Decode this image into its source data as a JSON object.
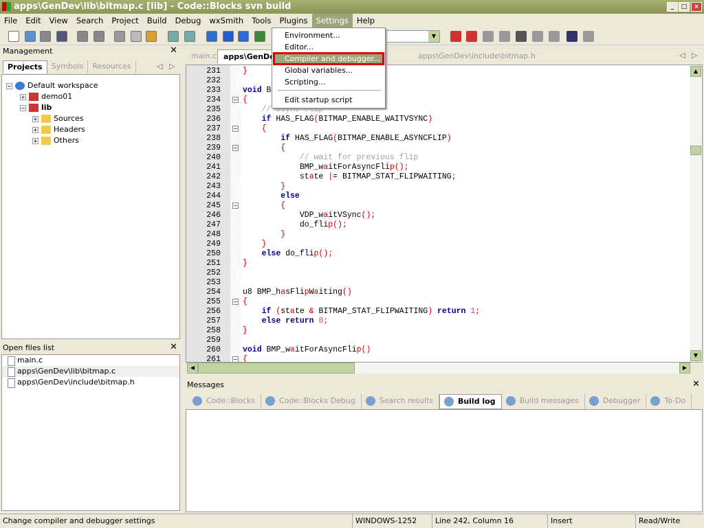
{
  "window": {
    "title": "apps\\GenDev\\lib\\bitmap.c [lib] - Code::Blocks svn build"
  },
  "menubar": [
    "File",
    "Edit",
    "View",
    "Search",
    "Project",
    "Build",
    "Debug",
    "wxSmith",
    "Tools",
    "Plugins",
    "Settings",
    "Help"
  ],
  "settings_menu": {
    "items": [
      "Environment...",
      "Editor...",
      "Compiler and debugger...",
      "Global variables...",
      "Scripting...",
      "Edit startup script"
    ],
    "highlighted": "Compiler and debugger..."
  },
  "management": {
    "title": "Management",
    "tabs": [
      "Projects",
      "Symbols",
      "Resources"
    ],
    "tree": [
      "Default workspace",
      "demo01",
      "lib",
      "Sources",
      "Headers",
      "Others"
    ]
  },
  "open_files": {
    "title": "Open files list",
    "files": [
      "main.c",
      "apps\\GenDev\\lib\\bitmap.c",
      "apps\\GenDev\\include\\bitmap.h"
    ]
  },
  "editor": {
    "tabs": [
      "main.c",
      "apps\\GenDev\\lib\\bitmap.c",
      "apps\\GenDev\\include\\bitmap.h"
    ],
    "lines": [
      {
        "n": "231",
        "t": "}"
      },
      {
        "n": "232",
        "t": ""
      },
      {
        "n": "233",
        "t": "void B"
      },
      {
        "n": "234",
        "t": "{"
      },
      {
        "n": "235",
        "t": "    // async flip"
      },
      {
        "n": "236",
        "t": "    if HAS_FLAG(BITMAP_ENABLE_WAITVSYNC)"
      },
      {
        "n": "237",
        "t": "    {"
      },
      {
        "n": "238",
        "t": "        if HAS_FLAG(BITMAP_ENABLE_ASYNCFLIP)"
      },
      {
        "n": "239",
        "t": "        {"
      },
      {
        "n": "240",
        "t": "            // wait for previous flip"
      },
      {
        "n": "241",
        "t": "            BMP_waitForAsyncFlip();"
      },
      {
        "n": "242",
        "t": "            state |= BITMAP_STAT_FLIPWAITING;"
      },
      {
        "n": "243",
        "t": "        }"
      },
      {
        "n": "244",
        "t": "        else"
      },
      {
        "n": "245",
        "t": "        {"
      },
      {
        "n": "246",
        "t": "            VDP_waitVSync();"
      },
      {
        "n": "247",
        "t": "            do_flip();"
      },
      {
        "n": "248",
        "t": "        }"
      },
      {
        "n": "249",
        "t": "    }"
      },
      {
        "n": "250",
        "t": "    else do_flip();"
      },
      {
        "n": "251",
        "t": "}"
      },
      {
        "n": "252",
        "t": ""
      },
      {
        "n": "253",
        "t": ""
      },
      {
        "n": "254",
        "t": "u8 BMP_hasFlipWaiting()"
      },
      {
        "n": "255",
        "t": "{"
      },
      {
        "n": "256",
        "t": "    if (state & BITMAP_STAT_FLIPWAITING) return 1;"
      },
      {
        "n": "257",
        "t": "    else return 0;"
      },
      {
        "n": "258",
        "t": "}"
      },
      {
        "n": "259",
        "t": ""
      },
      {
        "n": "260",
        "t": "void BMP_waitForAsyncFlip()"
      },
      {
        "n": "261",
        "t": "{"
      }
    ],
    "fold_lines": [
      "234",
      "237",
      "239",
      "245",
      "255",
      "261"
    ]
  },
  "messages": {
    "title": "Messages",
    "tabs": [
      "Code::Blocks",
      "Code::Blocks Debug",
      "Search results",
      "Build log",
      "Build messages",
      "Debugger",
      "To-Do"
    ],
    "active": "Build log"
  },
  "status": {
    "hint": "Change compiler and debugger settings",
    "encoding": "WINDOWS-1252",
    "position": "Line 242, Column 16",
    "mode": "Insert",
    "access": "Read/Write"
  }
}
